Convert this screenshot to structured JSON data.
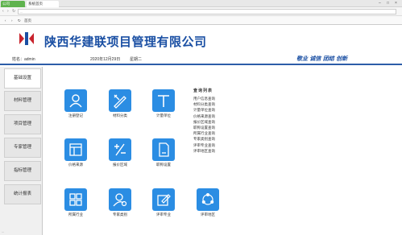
{
  "browser": {
    "tabs": [
      {
        "label": "公司"
      },
      {
        "label": "系统首页"
      }
    ],
    "address": "...",
    "bookmarks": [
      "首页"
    ]
  },
  "header": {
    "company_name": "陕西华建联项目管理有限公司"
  },
  "infobar": {
    "user_label": "姓名：admin",
    "date": "2020年12月29日",
    "weekday": "星期二",
    "slogan": "敬业  诚信  团结  创新"
  },
  "sidebar": {
    "items": [
      {
        "label": "基础设置"
      },
      {
        "label": "材料管理"
      },
      {
        "label": "项目管理"
      },
      {
        "label": "专家管理"
      },
      {
        "label": "指标管理"
      },
      {
        "label": "统计报表"
      }
    ],
    "footer": "..."
  },
  "grid": {
    "items": [
      {
        "label": "注册登记",
        "icon": "user-icon"
      },
      {
        "label": "材料分类",
        "icon": "pen-ruler-icon"
      },
      {
        "label": "计量单位",
        "icon": "text-t-icon"
      },
      {
        "label": "价格来源",
        "icon": "layout-icon"
      },
      {
        "label": "报价区域",
        "icon": "plus-minus-icon"
      },
      {
        "label": "职称设置",
        "icon": "document-icon"
      },
      {
        "label": "所属行业",
        "icon": "grid-icon"
      },
      {
        "label": "专家类别",
        "icon": "user-settings-icon"
      },
      {
        "label": "评审专业",
        "icon": "edit-icon"
      },
      {
        "label": "评审地区",
        "icon": "share-icon"
      }
    ]
  },
  "query": {
    "title": "查询列表",
    "items": [
      "用户信息查询",
      "材料分类查询",
      "计量单位查询",
      "价格来源查询",
      "报价区域查询",
      "职称设置查询",
      "所属行业查询",
      "专家类别查询",
      "评审专业查询",
      "评审地区查询"
    ]
  },
  "colors": {
    "accent": "#2b8de3",
    "brand": "#1a4fa3"
  }
}
